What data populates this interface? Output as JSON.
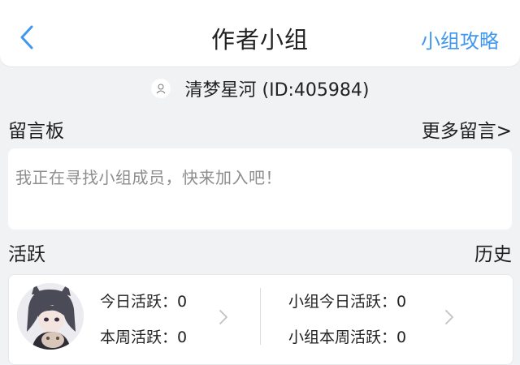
{
  "header": {
    "title": "作者小组",
    "right_link": "小组攻略"
  },
  "author": {
    "name": "清梦星河 (ID:405984)"
  },
  "message_board": {
    "title": "留言板",
    "more_link": "更多留言>",
    "message": "我正在寻找小组成员，快来加入吧！"
  },
  "activity": {
    "title": "活跃",
    "history_link": "历史",
    "today_label": "今日活跃：0",
    "week_label": "本周活跃：0",
    "group_today_label": "小组今日活跃：0",
    "group_week_label": "小组本周活跃：0"
  },
  "colors": {
    "accent": "#3f97f0",
    "background": "#f1f2f4"
  }
}
